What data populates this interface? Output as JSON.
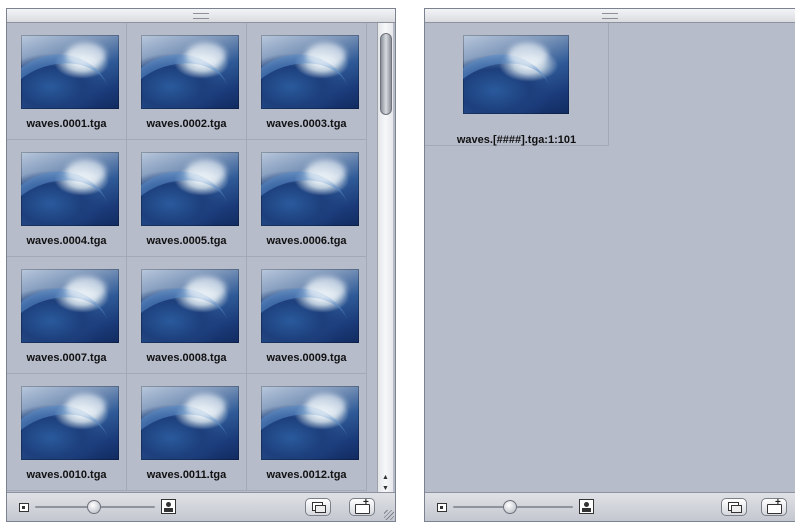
{
  "left_panel": {
    "items": [
      {
        "label": "waves.0001.tga"
      },
      {
        "label": "waves.0002.tga"
      },
      {
        "label": "waves.0003.tga"
      },
      {
        "label": "waves.0004.tga"
      },
      {
        "label": "waves.0005.tga"
      },
      {
        "label": "waves.0006.tga"
      },
      {
        "label": "waves.0007.tga"
      },
      {
        "label": "waves.0008.tga"
      },
      {
        "label": "waves.0009.tga"
      },
      {
        "label": "waves.0010.tga"
      },
      {
        "label": "waves.0011.tga"
      },
      {
        "label": "waves.0012.tga"
      }
    ],
    "thumbnail_size_fraction": 0.56,
    "scroll_position_fraction": 0.0
  },
  "right_panel": {
    "items": [
      {
        "label": "waves.[####].tga:1:101"
      }
    ],
    "thumbnail_size_fraction": 0.45
  },
  "icons": {
    "small_thumbnail": "small-thumbnail-icon",
    "large_thumbnail": "large-thumbnail-icon",
    "duplicate": "duplicate-icon",
    "new_folder": "new-folder-icon"
  },
  "colors": {
    "panel_background": "#b7bccb",
    "toolbar_background": "#d0d3da"
  }
}
